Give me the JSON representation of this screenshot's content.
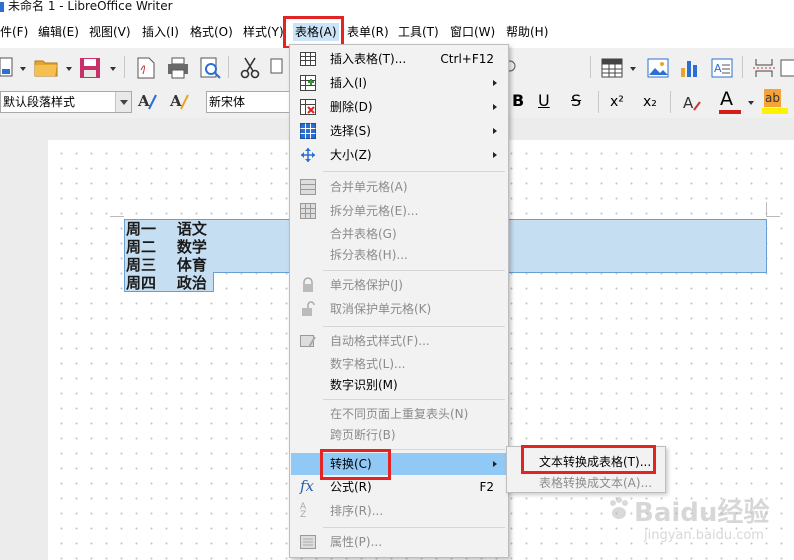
{
  "window": {
    "title": "未命名 1 - LibreOffice Writer"
  },
  "menubar": {
    "items": [
      "件(F)",
      "编辑(E)",
      "视图(V)",
      "插入(I)",
      "格式(O)",
      "样式(Y)",
      "表格(A)",
      "表单(R)",
      "工具(T)",
      "窗口(W)",
      "帮助(H)"
    ],
    "active": "表格(A)"
  },
  "toolbar": {
    "paragraph_style": "默认段落样式",
    "font_name": "新宋体",
    "bold": "B",
    "underline": "U",
    "strikethrough": "S",
    "superscript": "x²",
    "subscript": "x₂",
    "font_color_letter": "A",
    "highlight_letters": "ab"
  },
  "document": {
    "lines": [
      "周一    语文",
      "周二    数学",
      "周三    体育",
      "周四    政治"
    ]
  },
  "table_menu": {
    "items": [
      {
        "label": "插入表格(T)...",
        "shortcut": "Ctrl+F12",
        "icon": "insert-table-icon",
        "enabled": true,
        "submenu": false
      },
      {
        "label": "插入(I)",
        "icon": "insert-rows-icon",
        "enabled": true,
        "submenu": true
      },
      {
        "label": "删除(D)",
        "icon": "delete-table-icon",
        "enabled": true,
        "submenu": true
      },
      {
        "label": "选择(S)",
        "icon": "select-table-icon",
        "enabled": true,
        "submenu": true
      },
      {
        "label": "大小(Z)",
        "icon": "resize-icon",
        "enabled": true,
        "submenu": true
      },
      {
        "label": "合并单元格(A)",
        "icon": "merge-cells-icon",
        "enabled": false
      },
      {
        "label": "拆分单元格(E)...",
        "icon": "split-cells-icon",
        "enabled": false
      },
      {
        "label": "合并表格(G)",
        "enabled": false
      },
      {
        "label": "拆分表格(H)...",
        "enabled": false
      },
      {
        "label": "单元格保护(J)",
        "icon": "lock-icon",
        "enabled": false
      },
      {
        "label": "取消保护单元格(K)",
        "icon": "unlock-icon",
        "enabled": false
      },
      {
        "label": "自动格式样式(F)...",
        "icon": "autoformat-icon",
        "enabled": false
      },
      {
        "label": "数字格式(L)...",
        "enabled": false
      },
      {
        "label": "数字识别(M)",
        "enabled": true
      },
      {
        "label": "在不同页面上重复表头(N)",
        "enabled": false
      },
      {
        "label": "跨页断行(B)",
        "enabled": false
      },
      {
        "label": "转换(C)",
        "enabled": true,
        "submenu": true,
        "highlighted": true
      },
      {
        "label": "公式(R)",
        "shortcut": "F2",
        "icon": "formula-fx-icon",
        "enabled": true
      },
      {
        "label": "排序(R)...",
        "icon": "sort-az-icon",
        "enabled": false
      },
      {
        "label": "属性(P)...",
        "icon": "properties-icon",
        "enabled": false
      }
    ]
  },
  "convert_submenu": {
    "items": [
      {
        "label": "文本转换成表格(T)...",
        "enabled": true
      },
      {
        "label": "表格转换成文本(A)...",
        "enabled": false
      }
    ]
  },
  "watermark": {
    "brand": "Baidu经验",
    "url": "jingyan.baidu.com"
  },
  "colors": {
    "highlight": "#90c8f6",
    "annotation_red": "#e32424",
    "selection": "#c6def2"
  }
}
